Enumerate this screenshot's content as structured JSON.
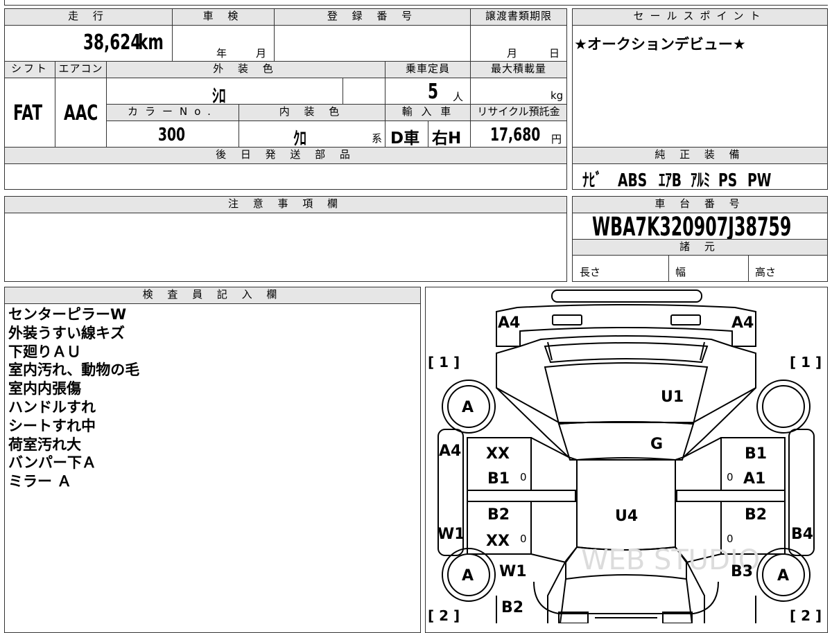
{
  "headers": {
    "mileage": "走 行",
    "inspection": "車 検",
    "registration": "登 録 番 号",
    "transfer_deadline": "譲渡書類期限",
    "sales_point": "セールスポイント",
    "shift": "シフト",
    "aircon": "エアコン",
    "exterior_color": "外 装 色",
    "capacity": "乗車定員",
    "max_load": "最大積載量",
    "color_no": "カラーNo.",
    "interior_color": "内 装 色",
    "import": "輸 入 車",
    "recycle": "リサイクル預託金",
    "later_parts": "後 日 発 送 部 品",
    "genuine_equipment": "純 正 装 備",
    "cautions": "注 意 事 項 欄",
    "chassis_number": "車 台 番 号",
    "specs": "諸 元",
    "inspector_notes": "検 査 員 記 入 欄"
  },
  "values": {
    "mileage": "38,624",
    "mileage_unit": "km",
    "year_unit": "年",
    "month_unit": "月",
    "deadline_month_unit": "月",
    "deadline_day_unit": "日",
    "sales_point": "★オークションデビュー★",
    "shift": "FAT",
    "aircon": "AAC",
    "exterior_color": "ｼﾛ",
    "capacity": "5",
    "capacity_unit": "人",
    "max_load_unit": "kg",
    "color_no": "300",
    "interior_color": "ｸﾛ",
    "interior_suffix": "系",
    "import_type": "D車",
    "steering": "右H",
    "recycle_fee": "17,680",
    "recycle_unit": "円",
    "genuine_equipment": [
      "ﾅﾋﾞ",
      "ABS",
      "ｴｱB",
      "ｱﾙﾐ",
      "PS",
      "PW"
    ],
    "chassis_number": "WBA7K320907J38759",
    "length_label": "長さ",
    "width_label": "幅",
    "height_label": "高さ"
  },
  "inspector_notes": [
    "センターピラーW",
    "外装うすい線キズ",
    "下廻りＡＵ",
    "室内汚れ、動物の毛",
    "室内内張傷",
    "ハンドルすれ",
    "シートすれ中",
    "荷室汚れ大",
    "バンパー下Ａ",
    "ミラー Ａ"
  ],
  "diagram": {
    "marks": [
      "A4",
      "A4",
      "U1",
      "G",
      "U4",
      "A4",
      "XX",
      "B1",
      "B2",
      "XX",
      "W1",
      "W1",
      "B2",
      "B1",
      "A1",
      "B2",
      "B4",
      "B3",
      "A",
      "A",
      "A"
    ],
    "bracket_top_left": "[ 1 ]",
    "bracket_top_right": "[ 1 ]",
    "bracket_bottom_left": "[ 2 ]",
    "bracket_bottom_right": "[ 2 ]",
    "watermark": "WEB STUDIO"
  }
}
